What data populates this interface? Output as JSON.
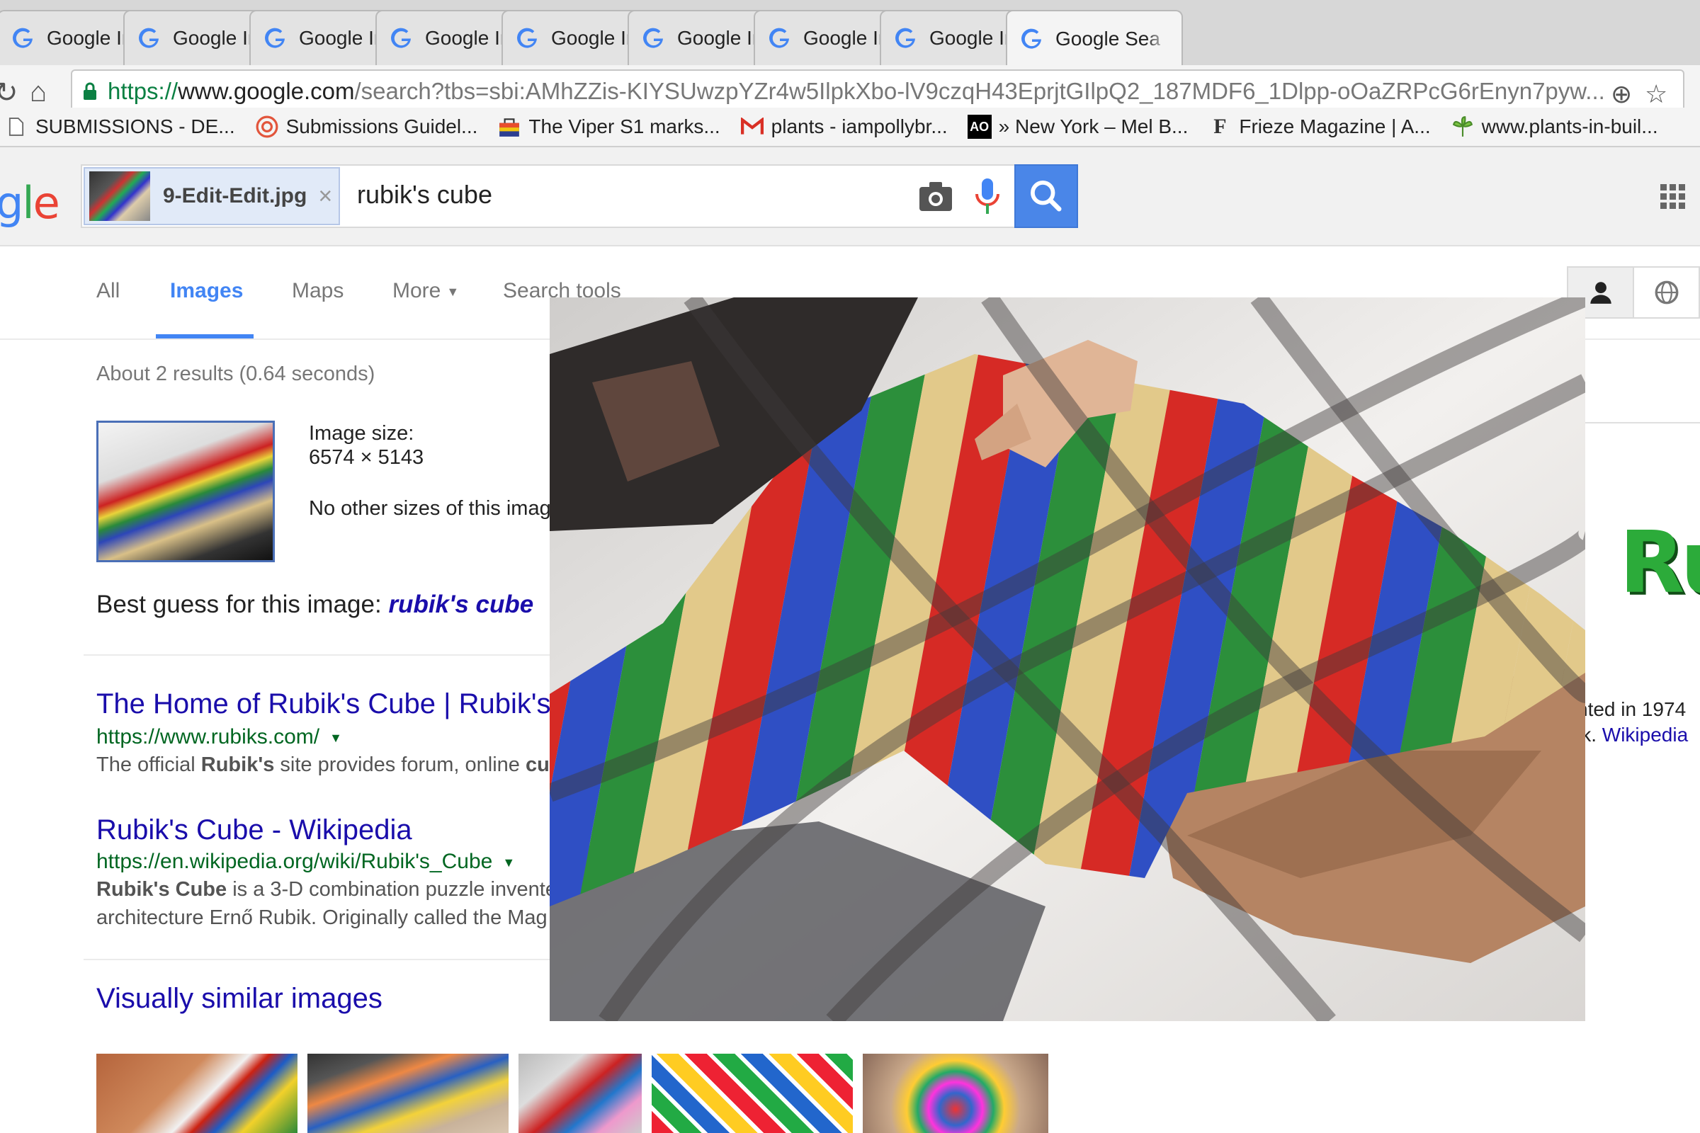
{
  "browser": {
    "tabs": [
      {
        "title": "Google Imag",
        "active": false
      },
      {
        "title": "Google Imag",
        "active": false
      },
      {
        "title": "Google Imag",
        "active": false
      },
      {
        "title": "Google Imag",
        "active": false
      },
      {
        "title": "Google Imag",
        "active": false
      },
      {
        "title": "Google Imag",
        "active": false
      },
      {
        "title": "Google Imag",
        "active": false
      },
      {
        "title": "Google Imag",
        "active": false
      },
      {
        "title": "Google Sea",
        "active": true
      }
    ],
    "tab_close_glyph": "×",
    "url": {
      "scheme": "https://",
      "host": "www.google.com",
      "path": "/search?tbs=sbi:AMhZZis-KIYSUwzpYZr4w5IlpkXbo-lV9czqH43EprjtGIlpQ2_187MDF6_1Dlpp-oOaZRPcG6rEnyn7pyw..."
    },
    "bookmarks": [
      {
        "label": "SUBMISSIONS - DE...",
        "icon": "page-icon"
      },
      {
        "label": "Submissions Guidel...",
        "icon": "swirl-icon"
      },
      {
        "label": "The Viper S1 marks...",
        "icon": "bag-icon"
      },
      {
        "label": "plants - iampollybr...",
        "icon": "gmail-icon"
      },
      {
        "label": "» New York – Mel B...",
        "icon": "ao-icon",
        "badge": "AO"
      },
      {
        "label": "Frieze Magazine | A...",
        "icon": "frieze-icon",
        "badge": "F"
      },
      {
        "label": "www.plants-in-buil...",
        "icon": "plant-icon"
      }
    ]
  },
  "google": {
    "logo_text": "gle",
    "search": {
      "image_chip_name": "9-Edit-Edit.jpg",
      "chip_close": "×",
      "query": "rubik's cube"
    },
    "nav_tabs": [
      "All",
      "Images",
      "Maps",
      "More",
      "Search tools"
    ],
    "selected_tab": "Images",
    "stats": "About 2 results (0.64 seconds)",
    "image_info": {
      "label": "Image size:",
      "size": "6574 × 5143",
      "other_sizes": "No other sizes of this image found."
    },
    "best_guess": {
      "prefix": "Best guess for this image:",
      "term": "rubik's cube"
    },
    "results": [
      {
        "title": "The Home of Rubik's Cube | Rubik's",
        "url": "https://www.rubiks.com/",
        "snippet_html_parts": [
          "The official ",
          "Rubik's",
          " site provides forum, online ",
          "cu"
        ]
      },
      {
        "title": "Rubik's Cube - Wikipedia",
        "url": "https://en.wikipedia.org/wiki/Rubik's_Cube",
        "snippet_line1_parts": [
          "Rubik's Cube",
          " is a 3-D combination puzzle invente"
        ],
        "snippet_line2": "architecture Ernő Rubik. Originally called the Mag"
      }
    ],
    "similar_title": "Visually similar images",
    "knowledge_panel": {
      "logo_text": "Ru",
      "line1": "nted in 1974",
      "line2_prefix": "ik. ",
      "line2_link": "Wikipedia"
    }
  },
  "colors": {
    "link": "#1a0dab",
    "url_green": "#006621",
    "accent_blue": "#4285f4",
    "stripe_red": "#d62a25",
    "stripe_blue": "#2f4fc4",
    "stripe_green": "#2c8f3b",
    "stripe_yellow": "#e2c98a"
  }
}
